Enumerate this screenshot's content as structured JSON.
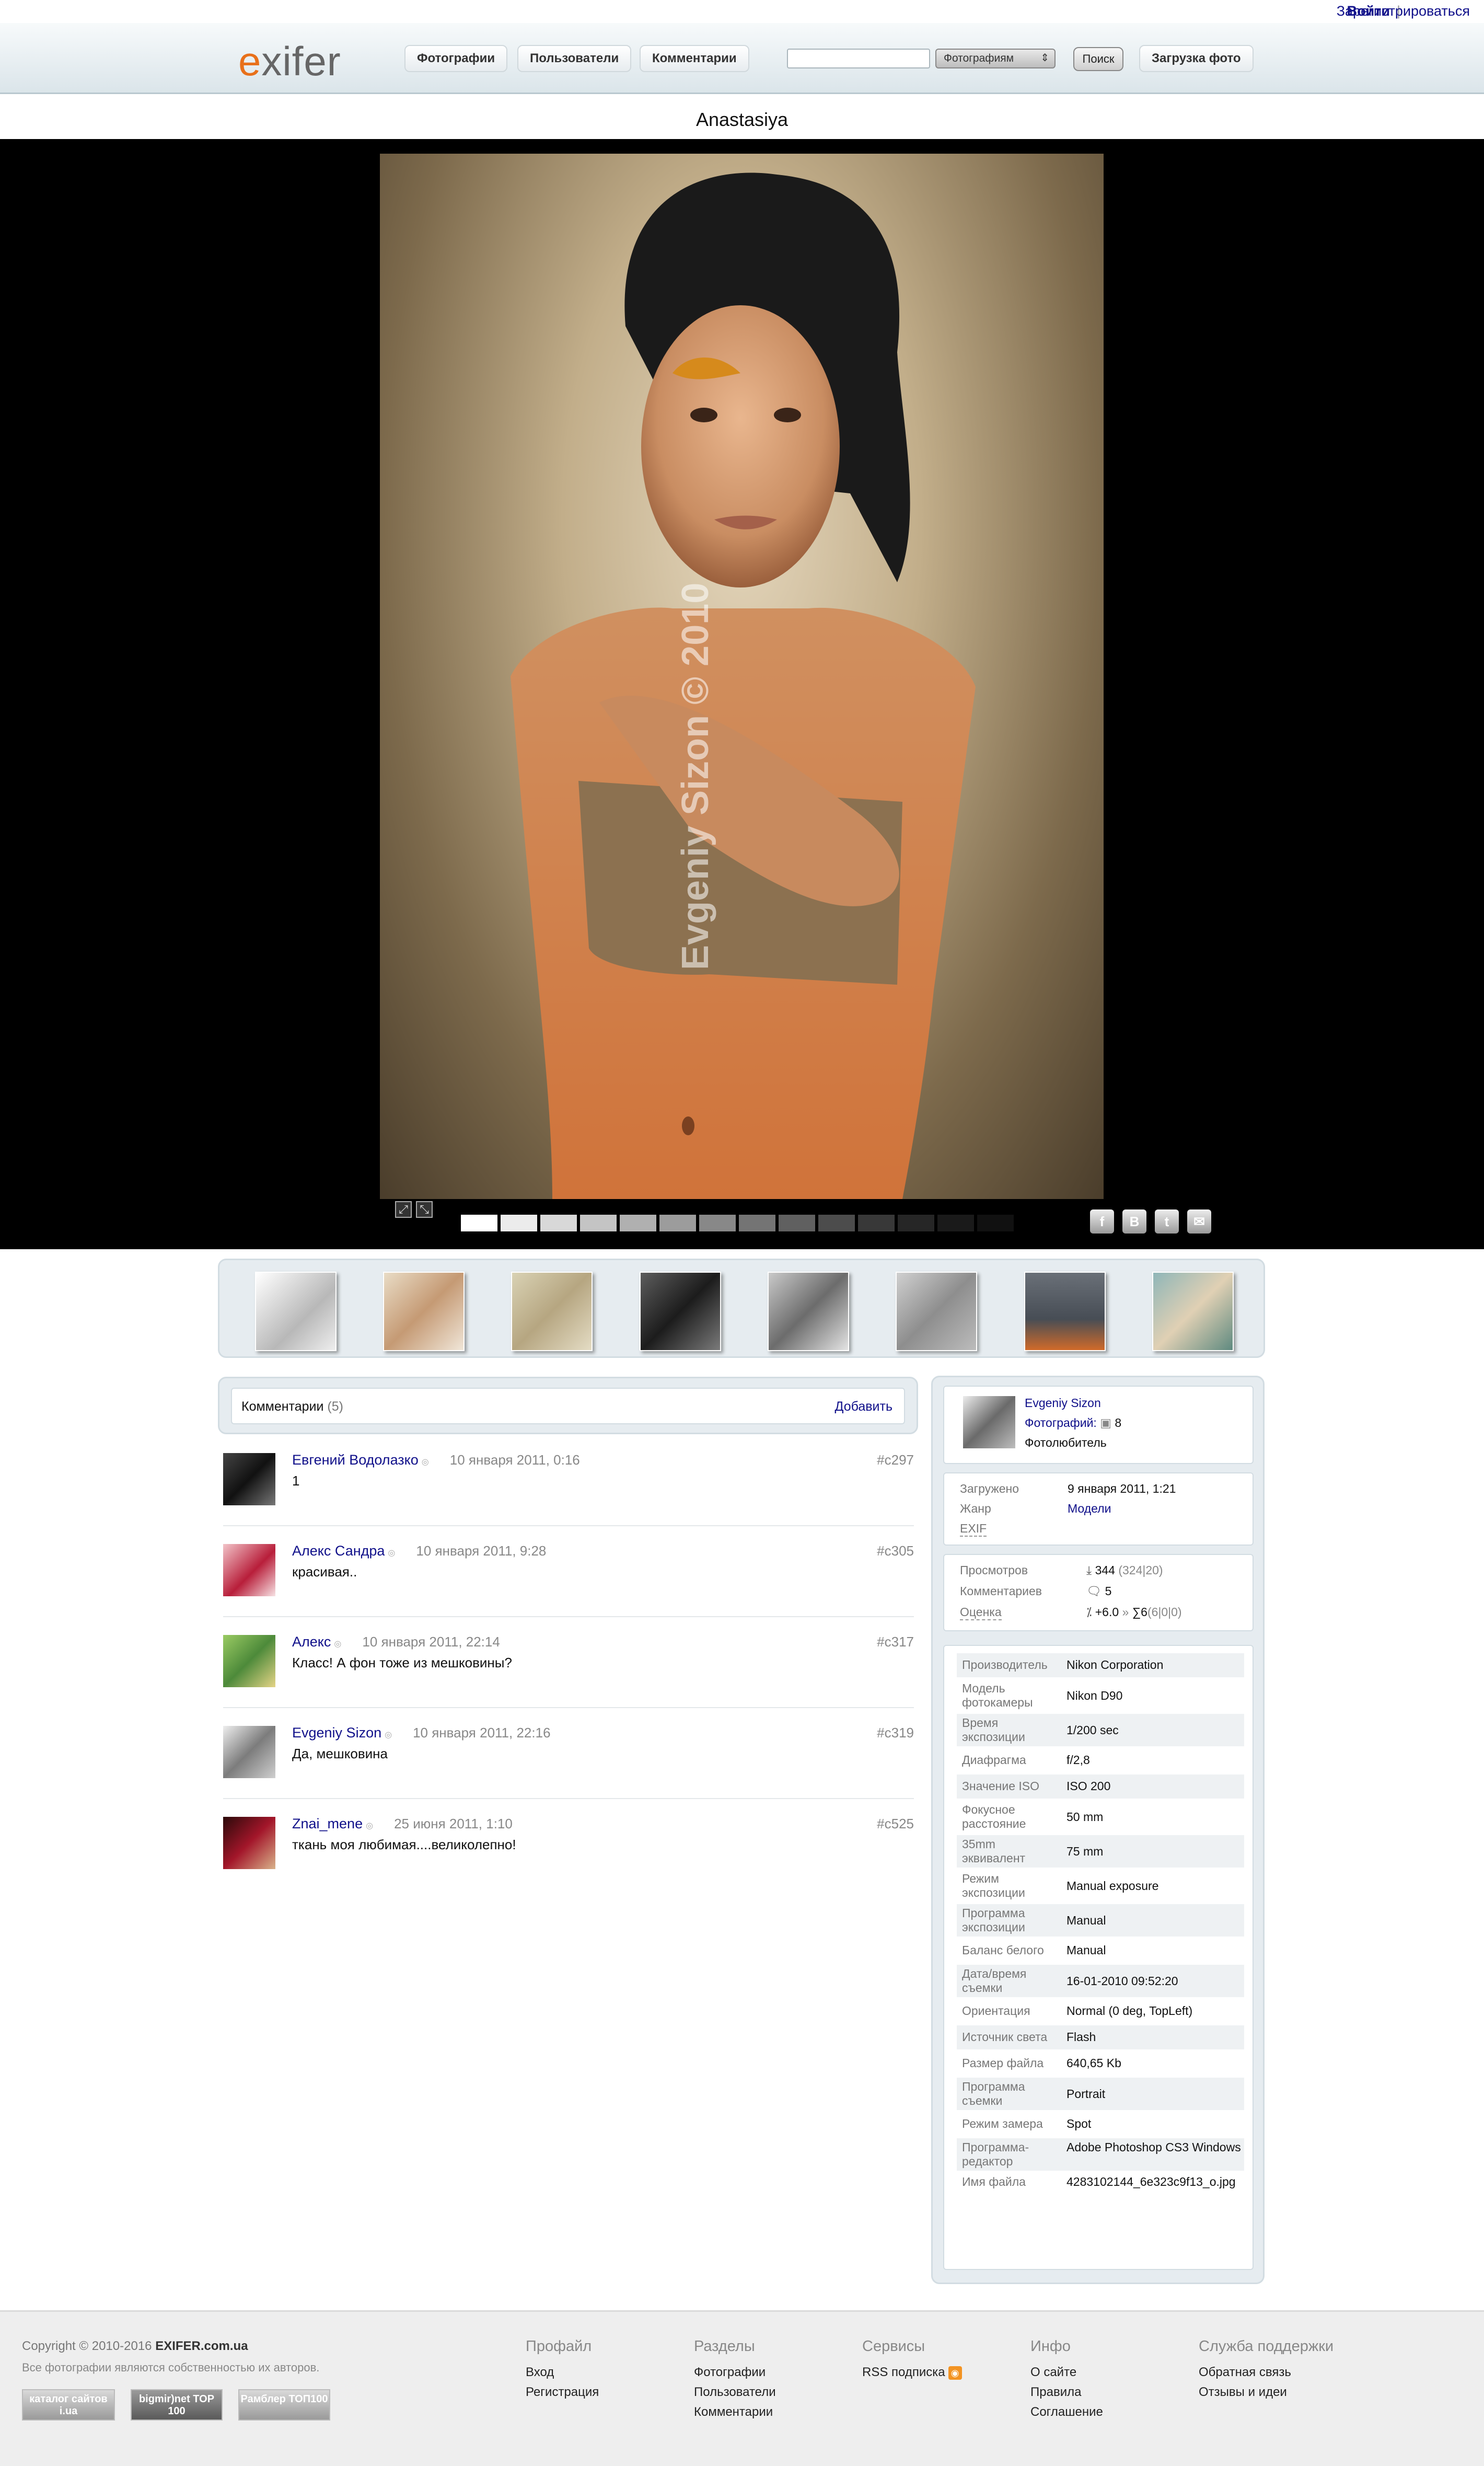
{
  "topbar": {
    "login": "Войти",
    "separator": "|",
    "register": "Зарегистрироваться"
  },
  "header": {
    "logo_e": "e",
    "logo_rest": "xifer",
    "nav": [
      "Фотографии",
      "Пользователи",
      "Комментарии"
    ],
    "search_placeholder": "",
    "search_select": "Фотографиям",
    "search_button": "Поиск",
    "upload_button": "Загрузка фото"
  },
  "photo": {
    "title": "Anastasiya",
    "watermark": "Evgeniy Sizon © 2010"
  },
  "stage": {
    "shade_colors": [
      "#ffffff",
      "#ececec",
      "#d8d8d8",
      "#c4c4c4",
      "#b0b0b0",
      "#9c9c9c",
      "#888888",
      "#747474",
      "#606060",
      "#4c4c4c",
      "#383838",
      "#262626",
      "#1a1a1a",
      "#111111"
    ],
    "share_icons": [
      {
        "name": "facebook-icon",
        "glyph": "f"
      },
      {
        "name": "vkontakte-icon",
        "glyph": "B"
      },
      {
        "name": "twitter-icon",
        "glyph": "t"
      },
      {
        "name": "bird-share-icon",
        "glyph": "✉"
      }
    ]
  },
  "comments": {
    "header_label": "Комментарии",
    "count": "(5)",
    "add_label": "Добавить",
    "items": [
      {
        "author": "Евгений Водолазко",
        "date": "10 января 2011, 0:16",
        "text": "1",
        "id": "#c297"
      },
      {
        "author": "Алекс Сандра",
        "date": "10 января 2011, 9:28",
        "text": "красивая..",
        "id": "#c305"
      },
      {
        "author": "Алекс",
        "date": "10 января 2011, 22:14",
        "text": "Класс! А фон тоже из мешковины?",
        "id": "#c317"
      },
      {
        "author": "Evgeniy Sizon",
        "date": "10 января 2011, 22:16",
        "text": "Да, мешковина",
        "id": "#c319"
      },
      {
        "author": "Znai_mene",
        "date": "25 июня 2011, 1:10",
        "text": "ткань моя любимая....великолепно!",
        "id": "#c525"
      }
    ]
  },
  "author": {
    "name": "Evgeniy Sizon",
    "photos_label": "Фотографий:",
    "photos_count": "8",
    "role": "Фотолюбитель"
  },
  "info": {
    "uploaded_label": "Загружено",
    "uploaded_value": "9 января 2011, 1:21",
    "genre_label": "Жанр",
    "genre_value": "Модели",
    "exif_label": "EXIF"
  },
  "stats": {
    "views_label": "Просмотров",
    "views_value": "344",
    "views_detail": "(324|20)",
    "comments_label": "Комментариев",
    "comments_value": "5",
    "rating_label": "Оценка",
    "rating_value": "+6.0",
    "rating_sep": "»",
    "rating_sum": "∑6",
    "rating_detail": "(6|0|0)"
  },
  "exif": [
    {
      "k": "Производитель",
      "v": "Nikon Corporation"
    },
    {
      "k": "Модель фотокамеры",
      "v": "Nikon D90"
    },
    {
      "k": "Время экспозиции",
      "v": "1/200 sec"
    },
    {
      "k": "Диафрагма",
      "v": "f/2,8"
    },
    {
      "k": "Значение ISO",
      "v": "ISO 200"
    },
    {
      "k": "Фокусное расстояние",
      "v": "50 mm"
    },
    {
      "k": "35mm эквивалент",
      "v": "75 mm"
    },
    {
      "k": "Режим экспозиции",
      "v": "Manual exposure"
    },
    {
      "k": "Программа экспозиции",
      "v": "Manual"
    },
    {
      "k": "Баланс белого",
      "v": "Manual"
    },
    {
      "k": "Дата/время съемки",
      "v": "16-01-2010 09:52:20"
    },
    {
      "k": "Ориентация",
      "v": "Normal (0 deg, TopLeft)"
    },
    {
      "k": "Источник света",
      "v": "Flash"
    },
    {
      "k": "Размер файла",
      "v": "640,65 Kb"
    },
    {
      "k": "Программа съемки",
      "v": "Portrait"
    },
    {
      "k": "Режим замера",
      "v": "Spot"
    },
    {
      "k": "Программа-редактор",
      "v": "Adobe Photoshop CS3 Windows"
    },
    {
      "k": "Имя файла",
      "v": "4283102144_6e323c9f13_o.jpg"
    }
  ],
  "footer": {
    "copyright_prefix": "Copyright © 2010-2016",
    "site": "EXIFER.com.ua",
    "rights": "Все фотографии являются собственностью их авторов.",
    "badges": [
      "каталог сайтов i.ua",
      "bigmir)net TOP 100",
      "Рамблер ТОП100"
    ],
    "columns": [
      {
        "title": "Профайл",
        "items": [
          "Вход",
          "Регистрация"
        ]
      },
      {
        "title": "Разделы",
        "items": [
          "Фотографии",
          "Пользователи",
          "Комментарии"
        ]
      },
      {
        "title": "Сервисы",
        "items": [
          "RSS подписка"
        ]
      },
      {
        "title": "Инфо",
        "items": [
          "О сайте",
          "Правила",
          "Соглашение"
        ]
      },
      {
        "title": "Служба поддержки",
        "items": [
          "Обратная связь",
          "Отзывы и идеи"
        ]
      }
    ]
  }
}
